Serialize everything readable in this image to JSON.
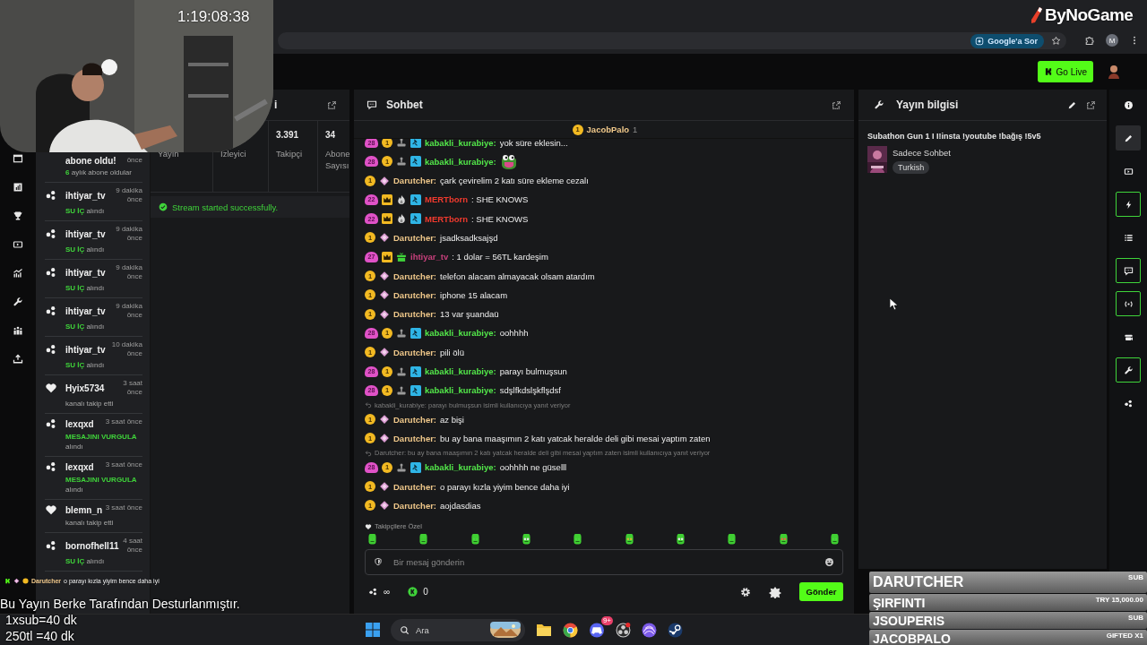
{
  "browser": {
    "ask_button": "Google'a Sor",
    "profile": "M"
  },
  "header": {
    "go_live": "Go Live"
  },
  "activity": [
    {
      "kind": "sub",
      "title": "abone oldu!",
      "time": "önce",
      "count": "6",
      "detail": "aylık abone oldular"
    },
    {
      "kind": "reward",
      "user": "ihtiyar_tv",
      "time": "9 dakika önce",
      "reward": "SU İÇ",
      "detail": "alındı"
    },
    {
      "kind": "reward",
      "user": "ihtiyar_tv",
      "time": "9 dakika önce",
      "reward": "SU İÇ",
      "detail": "alındı"
    },
    {
      "kind": "reward",
      "user": "ihtiyar_tv",
      "time": "9 dakika önce",
      "reward": "SU İÇ",
      "detail": "alındı"
    },
    {
      "kind": "reward",
      "user": "ihtiyar_tv",
      "time": "9 dakika önce",
      "reward": "SU İÇ",
      "detail": "alındı"
    },
    {
      "kind": "reward",
      "user": "ihtiyar_tv",
      "time": "10 dakika önce",
      "reward": "SU İÇ",
      "detail": "alındı"
    },
    {
      "kind": "follow",
      "user": "Hyix5734",
      "time": "3 saat önce",
      "detail": "kanalı takip etti"
    },
    {
      "kind": "reward",
      "user": "lexqxd",
      "time": "3 saat önce",
      "reward": "MESAJINI VURGULA",
      "detail": "alındı"
    },
    {
      "kind": "reward",
      "user": "lexqxd",
      "time": "3 saat önce",
      "reward": "MESAJINI VURGULA",
      "detail": "alındı"
    },
    {
      "kind": "follow",
      "user": "blemn_n",
      "time": "3 saat önce",
      "detail": "kanalı takip etti"
    },
    {
      "kind": "reward",
      "user": "bornofhell11",
      "time": "4 saat önce",
      "reward": "SU İÇ",
      "detail": "alındı"
    }
  ],
  "stats": {
    "title": "i",
    "cells": [
      {
        "label": "Yayın"
      },
      {
        "label": "İzleyici"
      },
      {
        "value": "3.391",
        "label": "Takipçi"
      },
      {
        "value": "34",
        "label": "Abone Sayısı"
      }
    ],
    "notice": "Stream started successfully."
  },
  "chat": {
    "title": "Sohbet",
    "pinned": {
      "badge": "1",
      "user": "JacobPalo",
      "count": "1"
    },
    "messages": [
      {
        "kind": "message",
        "badges": [
          {
            "kind": "sub",
            "text": "28"
          },
          {
            "kind": "coin",
            "text": "1"
          },
          {
            "kind": "gamepad"
          },
          {
            "kind": "mod"
          }
        ],
        "user": "kabakli_kurabiye:",
        "color": "#53e84a",
        "text": "yok süre eklesin..."
      },
      {
        "kind": "emote",
        "badges": [
          {
            "kind": "sub",
            "text": "28"
          },
          {
            "kind": "coin",
            "text": "1"
          },
          {
            "kind": "gamepad"
          },
          {
            "kind": "mod"
          }
        ],
        "user": "kabakli_kurabiye:",
        "color": "#53e84a"
      },
      {
        "kind": "message",
        "badges": [
          {
            "kind": "coin",
            "text": "1"
          },
          {
            "kind": "diamond"
          }
        ],
        "user": "Darutcher:",
        "color": "#f0c88a",
        "text": "çark çevirelim 2 katı süre ekleme cezalı"
      },
      {
        "kind": "message",
        "badges": [
          {
            "kind": "sub",
            "text": "22"
          },
          {
            "kind": "crown"
          },
          {
            "kind": "flame"
          },
          {
            "kind": "mod"
          }
        ],
        "user": "MERTborn",
        "color": "#f03a2e",
        "text": ": SHE KNOWS"
      },
      {
        "kind": "message",
        "badges": [
          {
            "kind": "sub",
            "text": "22"
          },
          {
            "kind": "crown"
          },
          {
            "kind": "flame"
          },
          {
            "kind": "mod"
          }
        ],
        "user": "MERTborn",
        "color": "#f03a2e",
        "text": ": SHE KNOWS"
      },
      {
        "kind": "message",
        "badges": [
          {
            "kind": "coin",
            "text": "1"
          },
          {
            "kind": "diamond"
          }
        ],
        "user": "Darutcher:",
        "color": "#f0c88a",
        "text": "jsadksadksajşd"
      },
      {
        "kind": "message",
        "badges": [
          {
            "kind": "sub",
            "text": "27"
          },
          {
            "kind": "crown"
          },
          {
            "kind": "gift"
          }
        ],
        "user": "ihtiyar_tv",
        "color": "#c8407c",
        "text": ": 1 dolar = 56TL kardeşim"
      },
      {
        "kind": "message",
        "badges": [
          {
            "kind": "coin",
            "text": "1"
          },
          {
            "kind": "diamond"
          }
        ],
        "user": "Darutcher:",
        "color": "#f0c88a",
        "text": "telefon alacam almayacak olsam atardım"
      },
      {
        "kind": "message",
        "badges": [
          {
            "kind": "coin",
            "text": "1"
          },
          {
            "kind": "diamond"
          }
        ],
        "user": "Darutcher:",
        "color": "#f0c88a",
        "text": "iphone 15 alacam"
      },
      {
        "kind": "message",
        "badges": [
          {
            "kind": "coin",
            "text": "1"
          },
          {
            "kind": "diamond"
          }
        ],
        "user": "Darutcher:",
        "color": "#f0c88a",
        "text": "13 var şuandaü"
      },
      {
        "kind": "message",
        "badges": [
          {
            "kind": "sub",
            "text": "28"
          },
          {
            "kind": "coin",
            "text": "1"
          },
          {
            "kind": "gamepad"
          },
          {
            "kind": "mod"
          }
        ],
        "user": "kabakli_kurabiye:",
        "color": "#53e84a",
        "text": "oohhhh"
      },
      {
        "kind": "message",
        "badges": [
          {
            "kind": "coin",
            "text": "1"
          },
          {
            "kind": "diamond"
          }
        ],
        "user": "Darutcher:",
        "color": "#f0c88a",
        "text": "pili ölü"
      },
      {
        "kind": "message",
        "badges": [
          {
            "kind": "sub",
            "text": "28"
          },
          {
            "kind": "coin",
            "text": "1"
          },
          {
            "kind": "gamepad"
          },
          {
            "kind": "mod"
          }
        ],
        "user": "kabakli_kurabiye:",
        "color": "#53e84a",
        "text": "parayı bulmuşsun"
      },
      {
        "kind": "message",
        "badges": [
          {
            "kind": "sub",
            "text": "28"
          },
          {
            "kind": "coin",
            "text": "1"
          },
          {
            "kind": "gamepad"
          },
          {
            "kind": "mod"
          }
        ],
        "user": "kabakli_kurabiye:",
        "color": "#53e84a",
        "text": "sdşlfkdslşkflşdsf"
      },
      {
        "kind": "reply",
        "text": "kabakli_kurabiye: parayı bulmuşsun isimli kullanıcıya yanıt veriyor"
      },
      {
        "kind": "message",
        "badges": [
          {
            "kind": "coin",
            "text": "1"
          },
          {
            "kind": "diamond"
          }
        ],
        "user": "Darutcher:",
        "color": "#f0c88a",
        "text": "az bişi"
      },
      {
        "kind": "message",
        "badges": [
          {
            "kind": "coin",
            "text": "1"
          },
          {
            "kind": "diamond"
          }
        ],
        "user": "Darutcher:",
        "color": "#f0c88a",
        "text": "bu ay bana maaşımın 2 katı yatcak heralde deli gibi mesai yaptım zaten"
      },
      {
        "kind": "reply",
        "text": "Darutcher: bu ay bana maaşımın 2 katı yatcak heralde deli gibi mesai yaptım zaten isimli kullanıcıya yanıt veriyor"
      },
      {
        "kind": "message",
        "badges": [
          {
            "kind": "sub",
            "text": "28"
          },
          {
            "kind": "coin",
            "text": "1"
          },
          {
            "kind": "gamepad"
          },
          {
            "kind": "mod"
          }
        ],
        "user": "kabakli_kurabiye:",
        "color": "#53e84a",
        "text": "oohhhh ne güselll"
      },
      {
        "kind": "message",
        "badges": [
          {
            "kind": "coin",
            "text": "1"
          },
          {
            "kind": "diamond"
          }
        ],
        "user": "Darutcher:",
        "color": "#f0c88a",
        "text": "o parayı kızla yiyim bence daha iyi"
      },
      {
        "kind": "message",
        "badges": [
          {
            "kind": "coin",
            "text": "1"
          },
          {
            "kind": "diamond"
          }
        ],
        "user": "Darutcher:",
        "color": "#f0c88a",
        "text": "aojdasdias"
      }
    ],
    "emote_section": "Takipçilere Özel",
    "input_placeholder": "Bir mesaj gönderin",
    "points": "∞",
    "kicks": "0",
    "send": "Gönder"
  },
  "stream_info": {
    "title": "Yayın bilgisi",
    "stream_title": "Subathon Gun 1 I I!insta !youtube !bağış !5v5",
    "category": "Sadece Sohbet",
    "tag": "Turkish"
  },
  "right_rail": [
    {
      "kind": "info",
      "outlined": false,
      "selected": false
    },
    {
      "kind": "pencil",
      "outlined": false,
      "selected": true
    },
    {
      "kind": "film",
      "outlined": false,
      "selected": false
    },
    {
      "kind": "bolt",
      "outlined": true,
      "selected": false
    },
    {
      "kind": "list",
      "outlined": false,
      "selected": false
    },
    {
      "kind": "chat",
      "outlined": true,
      "selected": false
    },
    {
      "kind": "broadcast",
      "outlined": true,
      "selected": false
    },
    {
      "kind": "camera",
      "outlined": false,
      "selected": false
    },
    {
      "kind": "wrench",
      "outlined": true,
      "selected": false
    },
    {
      "kind": "dots",
      "outlined": false,
      "selected": false
    }
  ],
  "taskbar": {
    "search_placeholder": "Ara",
    "notification_count": "9+"
  },
  "overlay": {
    "timer": "1:19:08:38",
    "logo": "ByNoGame",
    "chat_line": {
      "user": "Darutcher",
      "text": "o parayı kızla yiyim bence daha iyi"
    },
    "sponsor_lines": [
      "Bu Yayın Berke Tarafından Desturlanmıştır.",
      "1xsub=40 dk",
      "250tl =40 dk"
    ],
    "events": [
      {
        "name": "DARUTCHER",
        "amount": "SUB"
      },
      {
        "name": "ŞIRFINTI",
        "amount": "TRY 15,000.00"
      },
      {
        "name": "JSOUPERIS",
        "amount": "SUB"
      },
      {
        "name": "JACOBPALO",
        "amount": "GIFTED X1"
      }
    ]
  }
}
